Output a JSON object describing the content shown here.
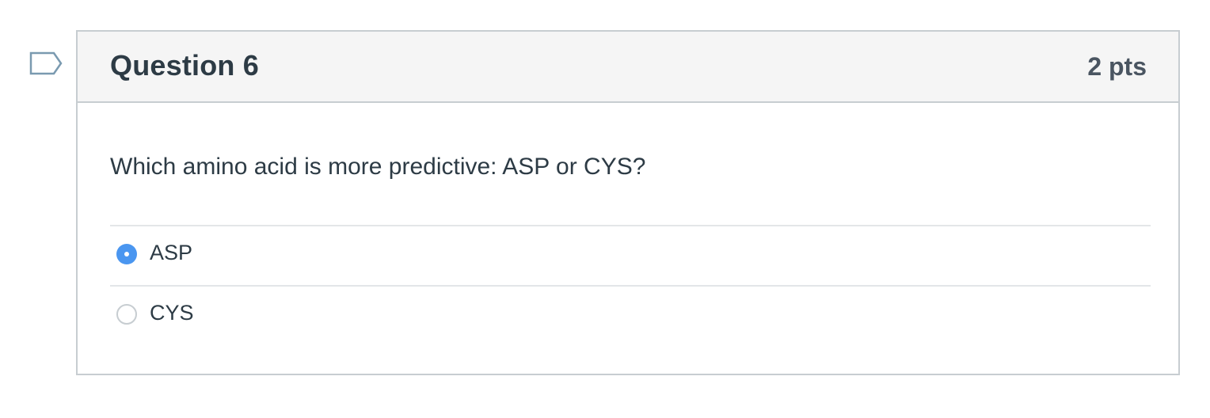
{
  "question": {
    "title": "Question 6",
    "points": "2 pts",
    "text": "Which amino acid is more predictive: ASP or CYS?",
    "answers": [
      {
        "label": "ASP",
        "selected": true
      },
      {
        "label": "CYS",
        "selected": false
      }
    ]
  },
  "flag": {
    "icon": "bookmark-flag-icon",
    "color": "#7a9ab0"
  },
  "colors": {
    "accent": "#4a96f0",
    "border": "#c7cdd1",
    "header_bg": "#f5f5f5",
    "text": "#2d3b45"
  }
}
